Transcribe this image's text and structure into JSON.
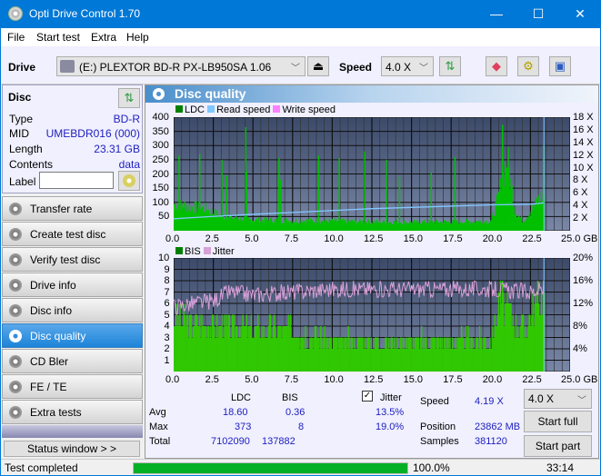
{
  "window": {
    "title": "Opti Drive Control 1.70",
    "minimize": "—",
    "maximize": "☐",
    "close": "✕"
  },
  "menu": [
    "File",
    "Start test",
    "Extra",
    "Help"
  ],
  "toolbar": {
    "drive_label": "Drive",
    "drive_value": "(E:)  PLEXTOR BD-R  PX-LB950SA 1.06",
    "speed_label": "Speed",
    "speed_value": "4.0 X"
  },
  "disc": {
    "header": "Disc",
    "type_k": "Type",
    "type_v": "BD-R",
    "mid_k": "MID",
    "mid_v": "UMEBDR016 (000)",
    "length_k": "Length",
    "length_v": "23.31 GB",
    "contents_k": "Contents",
    "contents_v": "data",
    "label_k": "Label",
    "label_v": ""
  },
  "nav": [
    {
      "label": "Transfer rate"
    },
    {
      "label": "Create test disc"
    },
    {
      "label": "Verify test disc"
    },
    {
      "label": "Drive info"
    },
    {
      "label": "Disc info"
    },
    {
      "label": "Disc quality",
      "active": true
    },
    {
      "label": "CD Bler"
    },
    {
      "label": "FE / TE"
    },
    {
      "label": "Extra tests"
    }
  ],
  "status_window": "Status window > >",
  "panel": {
    "title": "Disc quality"
  },
  "chart_data": [
    {
      "type": "bar",
      "title": "LDC / Read speed",
      "legend": [
        "LDC",
        "Read speed",
        "Write speed"
      ],
      "legend_colors": [
        "#008000",
        "#80c8ff",
        "#ff80ff"
      ],
      "x_ticks": [
        "0.0",
        "2.5",
        "5.0",
        "7.5",
        "10.0",
        "12.5",
        "15.0",
        "17.5",
        "20.0",
        "22.5",
        "25.0 GB"
      ],
      "y_ticks": [
        "400",
        "350",
        "300",
        "250",
        "200",
        "150",
        "100",
        "50"
      ],
      "y2_ticks": [
        "18 X",
        "16 X",
        "14 X",
        "12 X",
        "10 X",
        "8 X",
        "6 X",
        "4 X",
        "2 X"
      ],
      "xlim": [
        0,
        25
      ],
      "ylim": [
        0,
        400
      ],
      "y2lim": [
        0,
        18
      ],
      "ldc_baseline": [
        [
          0,
          110
        ],
        [
          2,
          90
        ],
        [
          3,
          60
        ],
        [
          5,
          45
        ],
        [
          10,
          40
        ],
        [
          15,
          35
        ],
        [
          20,
          40
        ],
        [
          20.5,
          150
        ],
        [
          21,
          300
        ],
        [
          21.5,
          80
        ],
        [
          22,
          40
        ],
        [
          23,
          130
        ],
        [
          23.3,
          150
        ]
      ],
      "ldc_spikes": [
        [
          0.3,
          265
        ],
        [
          1.6,
          270
        ],
        [
          3.0,
          250
        ],
        [
          3.3,
          195
        ],
        [
          4.5,
          365
        ],
        [
          4.55,
          210
        ],
        [
          6.6,
          255
        ],
        [
          6.7,
          180
        ],
        [
          9.1,
          265
        ],
        [
          10.4,
          255
        ],
        [
          12.0,
          280
        ],
        [
          13.4,
          250
        ],
        [
          14.2,
          190
        ],
        [
          16.2,
          205
        ],
        [
          17.7,
          260
        ],
        [
          20.7,
          373
        ],
        [
          23.3,
          300
        ]
      ],
      "read_speed": [
        [
          0,
          1.9
        ],
        [
          2,
          2.2
        ],
        [
          5,
          2.6
        ],
        [
          7.5,
          2.9
        ],
        [
          10,
          3.2
        ],
        [
          12.5,
          3.5
        ],
        [
          15,
          3.7
        ],
        [
          17.5,
          3.9
        ],
        [
          20,
          4.1
        ],
        [
          22.5,
          4.2
        ],
        [
          23.3,
          4.4
        ]
      ]
    },
    {
      "type": "bar",
      "title": "BIS / Jitter",
      "legend": [
        "BIS",
        "Jitter"
      ],
      "legend_colors": [
        "#008000",
        "#d8a0d8"
      ],
      "x_ticks": [
        "0.0",
        "2.5",
        "5.0",
        "7.5",
        "10.0",
        "12.5",
        "15.0",
        "17.5",
        "20.0",
        "22.5",
        "25.0 GB"
      ],
      "y_ticks": [
        "10",
        "9",
        "8",
        "7",
        "6",
        "5",
        "4",
        "3",
        "2",
        "1"
      ],
      "y2_ticks": [
        "20%",
        "16%",
        "12%",
        "8%",
        "4%"
      ],
      "xlim": [
        0,
        25
      ],
      "ylim": [
        0,
        10
      ],
      "y2lim": [
        0,
        20
      ],
      "bis_baseline": [
        [
          0,
          5
        ],
        [
          5,
          4
        ],
        [
          7.5,
          4
        ],
        [
          10,
          3
        ],
        [
          12.5,
          3
        ],
        [
          20,
          3
        ],
        [
          20.5,
          7
        ],
        [
          21,
          6
        ],
        [
          22,
          4
        ],
        [
          23.3,
          8
        ]
      ],
      "jitter": [
        [
          0,
          11.5
        ],
        [
          2.5,
          12.5
        ],
        [
          3.5,
          14
        ],
        [
          5,
          13.5
        ],
        [
          7.5,
          14
        ],
        [
          10,
          14.5
        ],
        [
          12.5,
          14.5
        ],
        [
          15,
          14.5
        ],
        [
          17.5,
          14.5
        ],
        [
          20,
          14.5
        ],
        [
          22.5,
          14
        ],
        [
          23.3,
          14.5
        ]
      ]
    }
  ],
  "stats": {
    "col_ldc": "LDC",
    "col_bis": "BIS",
    "jitter_label": "Jitter",
    "jitter_checked": true,
    "avg_label": "Avg",
    "avg_ldc": "18.60",
    "avg_bis": "0.36",
    "avg_jitter": "13.5%",
    "max_label": "Max",
    "max_ldc": "373",
    "max_bis": "8",
    "max_jitter": "19.0%",
    "total_label": "Total",
    "total_ldc": "7102090",
    "total_bis": "137882",
    "speed_label": "Speed",
    "speed_value": "4.19 X",
    "position_label": "Position",
    "position_value": "23862 MB",
    "samples_label": "Samples",
    "samples_value": "381120",
    "speed_select": "4.0 X",
    "start_full": "Start full",
    "start_part": "Start part"
  },
  "statusbar": {
    "text": "Test completed",
    "progress": 1.0,
    "percent": "100.0%",
    "time": "33:14"
  }
}
